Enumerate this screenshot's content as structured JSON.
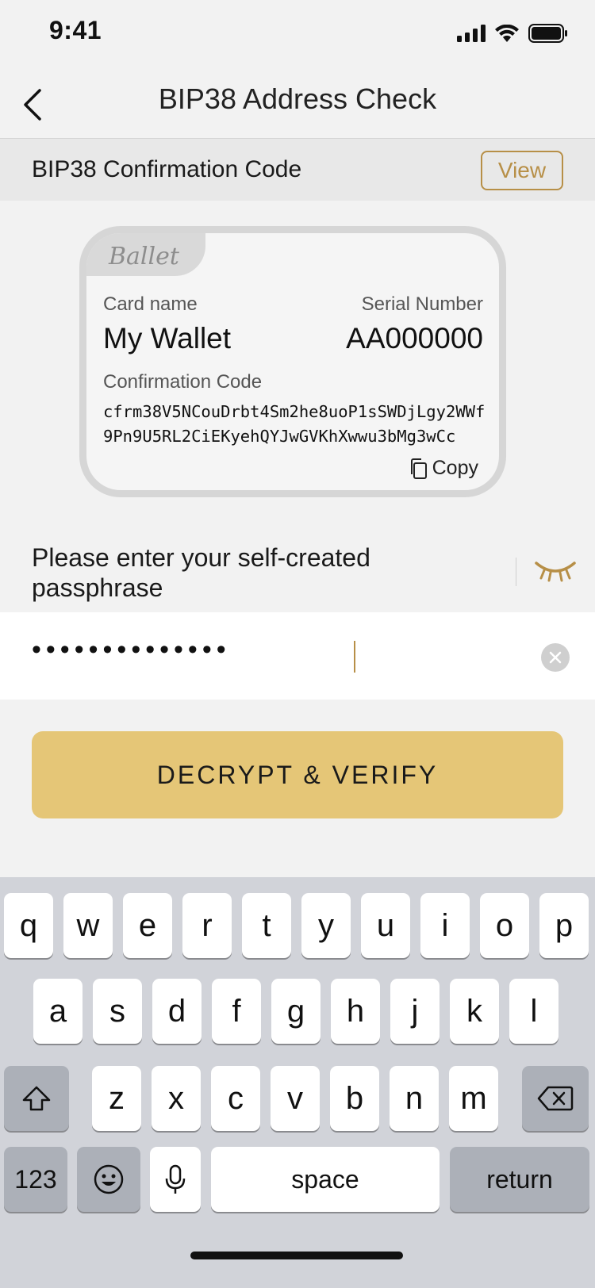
{
  "status_bar": {
    "time": "9:41"
  },
  "nav": {
    "title": "BIP38 Address Check"
  },
  "confirmation_row": {
    "label": "BIP38 Confirmation Code",
    "view_button": "View"
  },
  "card": {
    "logo": "Ballet",
    "card_name_label": "Card name",
    "card_name": "My Wallet",
    "serial_label": "Serial Number",
    "serial_value": "AA000000",
    "confirmation_label": "Confirmation Code",
    "confirmation_code": "cfrm38V5NCouDrbt4Sm2he8uoP1sSWDjLgy2WWf9Pn9U5RL2CiEKyehQYJwGVKhXwwu3bMg3wCc",
    "copy_label": "Copy"
  },
  "passphrase": {
    "label": "Please enter your self-created passphrase",
    "masked_value": "••••••••••••••"
  },
  "decrypt_button": "DECRYPT & VERIFY",
  "keyboard": {
    "row1": [
      "q",
      "w",
      "e",
      "r",
      "t",
      "y",
      "u",
      "i",
      "o",
      "p"
    ],
    "row2": [
      "a",
      "s",
      "d",
      "f",
      "g",
      "h",
      "j",
      "k",
      "l"
    ],
    "row3": [
      "z",
      "x",
      "c",
      "v",
      "b",
      "n",
      "m"
    ],
    "numbers_key": "123",
    "space_key": "space",
    "return_key": "return"
  },
  "colors": {
    "accent": "#b78f47",
    "button": "#e5c677"
  }
}
